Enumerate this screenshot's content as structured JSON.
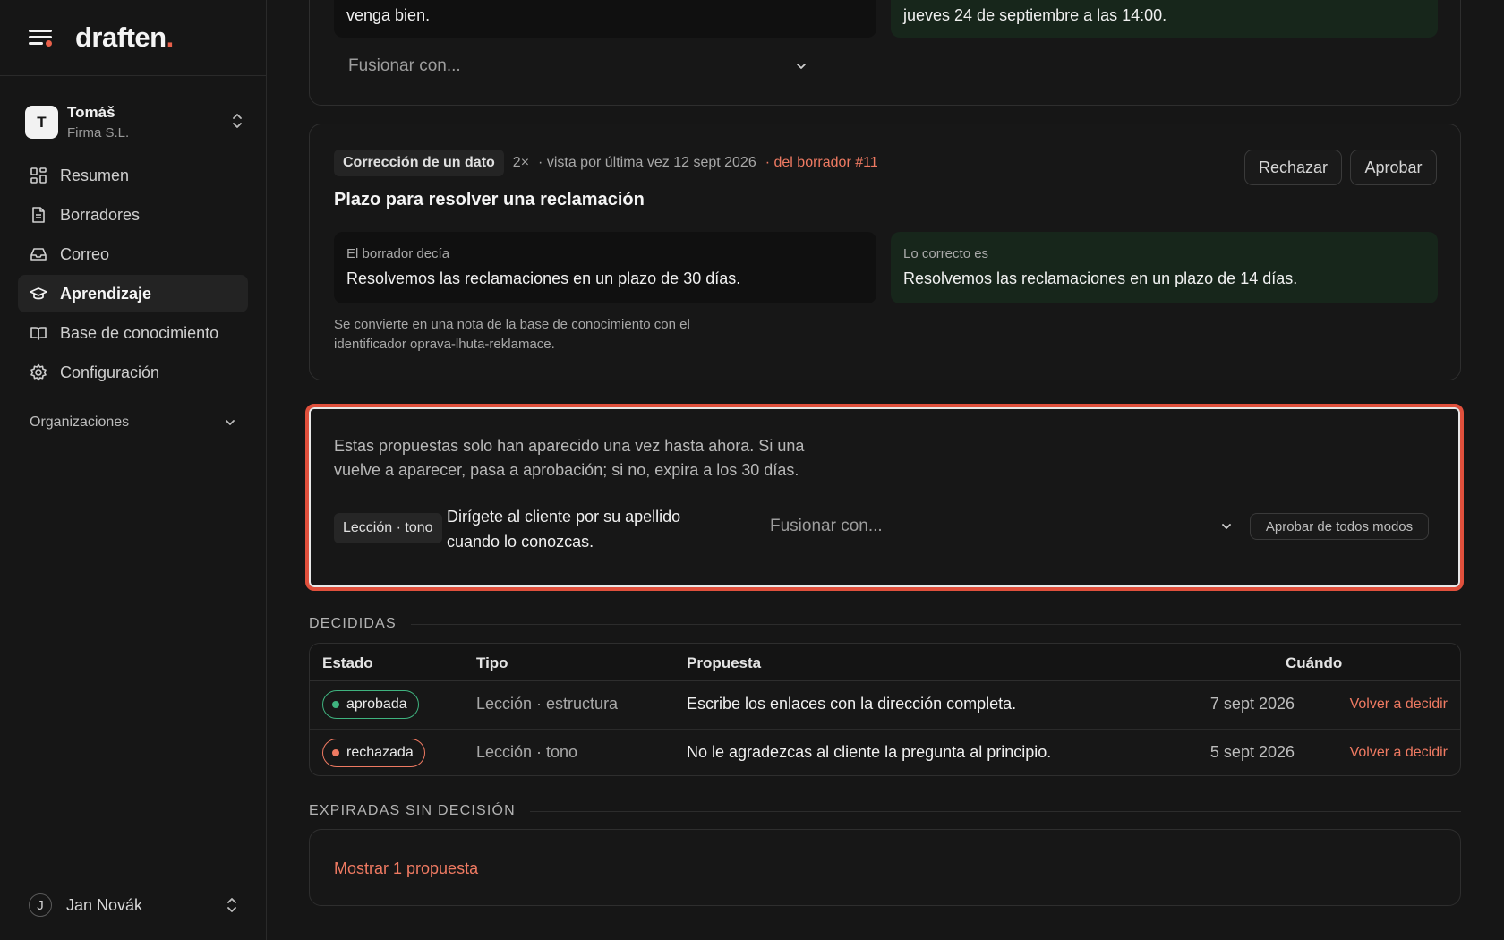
{
  "brand": {
    "name": "draften",
    "accent": "#e8604a"
  },
  "account": {
    "initial": "T",
    "name": "Tomáš",
    "org": "Firma S.L."
  },
  "nav": [
    {
      "label": "Resumen",
      "icon": "dashboard-icon"
    },
    {
      "label": "Borradores",
      "icon": "document-icon"
    },
    {
      "label": "Correo",
      "icon": "inbox-icon"
    },
    {
      "label": "Aprendizaje",
      "icon": "graduation-cap-icon",
      "active": true
    },
    {
      "label": "Base de conocimiento",
      "icon": "book-icon"
    },
    {
      "label": "Configuración",
      "icon": "gear-icon"
    }
  ],
  "organizations_label": "Organizaciones",
  "user": {
    "initial": "J",
    "name": "Jan Novák"
  },
  "card1": {
    "old_text": "venga bien.",
    "new_text": "jueves 24 de septiembre a las 14:00.",
    "merge_placeholder": "Fusionar con..."
  },
  "card2": {
    "tag": "Corrección de un dato",
    "count": "2×",
    "seen": "· vista por última vez 12 sept 2026",
    "source": "· del borrador #11",
    "reject_label": "Rechazar",
    "approve_label": "Aprobar",
    "title": "Plazo para resolver una reclamación",
    "old_label": "El borrador decía",
    "old_text": "Resolvemos las reclamaciones en un plazo de 30 días.",
    "new_label": "Lo correcto es",
    "new_text": "Resolvemos las reclamaciones en un plazo de 14 días.",
    "note": "Se convierte en una nota de la base de conocimiento con el identificador oprava-lhuta-reklamace."
  },
  "pending_single": {
    "intro": "Estas propuestas solo han aparecido una vez hasta ahora. Si una vuelve a aparecer, pasa a aprobación; si no, expira a los 30 días.",
    "tag": "Lección · tono",
    "text": "Dirígete al cliente por su apellido cuando lo conozcas.",
    "merge_placeholder": "Fusionar con...",
    "approve_anyway_label": "Aprobar de todos modos"
  },
  "decided": {
    "heading": "DECIDIDAS",
    "columns": {
      "estado": "Estado",
      "tipo": "Tipo",
      "propuesta": "Propuesta",
      "cuando": "Cuándo"
    },
    "rows": [
      {
        "status": "aprobada",
        "status_color": "#3fb37f",
        "type": "Lección · estructura",
        "proposal": "Escribe los enlaces con la dirección completa.",
        "when": "7 sept 2026",
        "action": "Volver a decidir"
      },
      {
        "status": "rechazada",
        "status_color": "#ef7a62",
        "type": "Lección · tono",
        "proposal": "No le agradezcas al cliente la pregunta al principio.",
        "when": "5 sept 2026",
        "action": "Volver a decidir"
      }
    ]
  },
  "expired": {
    "heading": "EXPIRADAS SIN DECISIÓN",
    "show_label": "Mostrar 1 propuesta"
  }
}
